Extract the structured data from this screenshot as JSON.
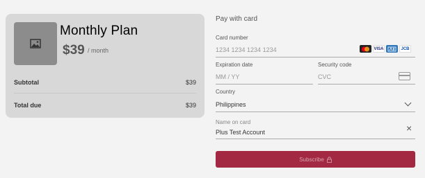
{
  "plan": {
    "name": "Monthly Plan",
    "price": "$39",
    "period": "/ month",
    "image_icon": "image-placeholder-icon"
  },
  "summary": {
    "subtotal_label": "Subtotal",
    "subtotal_value": "$39",
    "total_label": "Total due",
    "total_value": "$39"
  },
  "payment": {
    "title": "Pay with card",
    "card_number_label": "Card number",
    "card_number_placeholder": "1234 1234 1234 1234",
    "card_brands": [
      "mastercard",
      "visa",
      "amex",
      "jcb"
    ],
    "visa_text": "VISA",
    "jcb_text": "JCB",
    "expiration_label": "Expiration date",
    "expiration_placeholder": "MM / YY",
    "security_label": "Security code",
    "security_placeholder": "CVC",
    "country_label": "Country",
    "country_value": "Philippines",
    "name_label": "Name on card",
    "name_value": "Plus Test Account",
    "subscribe_label": "Subscribe"
  },
  "colors": {
    "subscribe_bg": "#a32942",
    "card_bg": "#d8d8d8",
    "page_bg": "#f3f3f3"
  }
}
